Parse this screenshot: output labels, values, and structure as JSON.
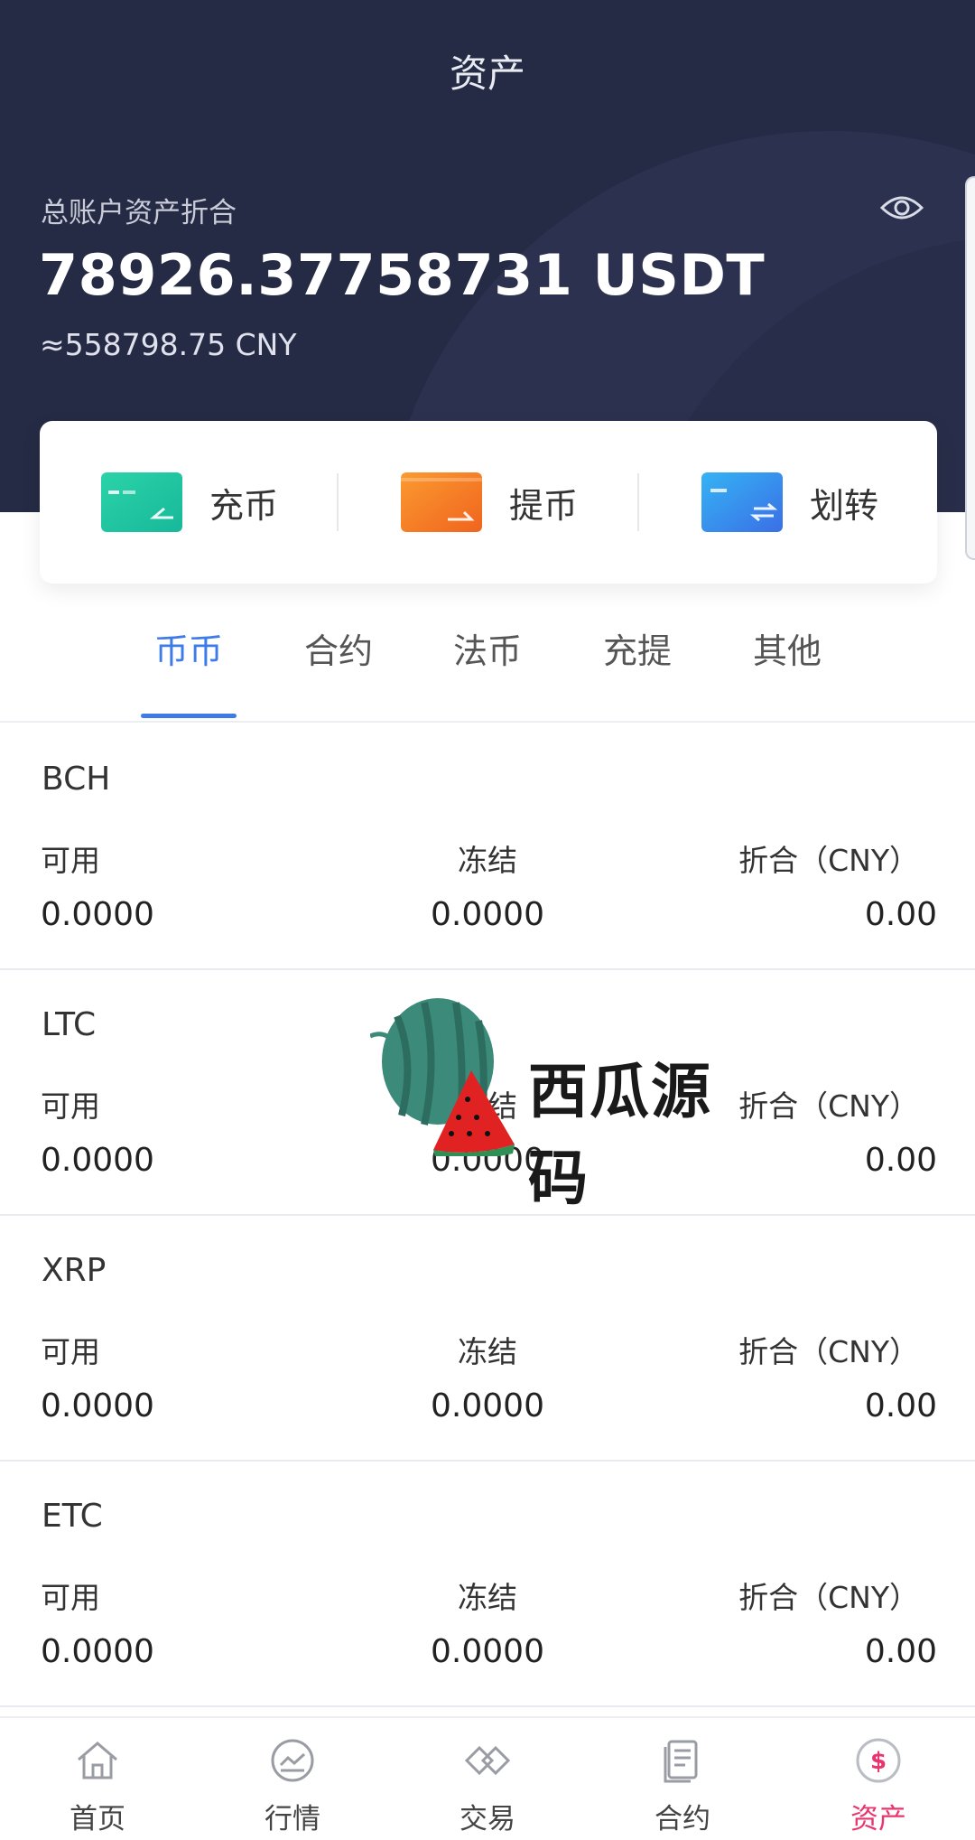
{
  "header": {
    "title": "资产",
    "assets_label": "总账户资产折合",
    "total_amount": "78926.37758731 USDT",
    "total_cny": "≈558798.75 CNY"
  },
  "actions": [
    {
      "label": "充币",
      "icon": "deposit-card-icon",
      "color": "#1fc7a3"
    },
    {
      "label": "提币",
      "icon": "withdraw-wallet-icon",
      "color": "#f47b27"
    },
    {
      "label": "划转",
      "icon": "transfer-card-icon",
      "color": "#3c8ff0"
    }
  ],
  "tabs": [
    {
      "label": "币币",
      "active": true
    },
    {
      "label": "合约",
      "active": false
    },
    {
      "label": "法币",
      "active": false
    },
    {
      "label": "充提",
      "active": false
    },
    {
      "label": "其他",
      "active": false
    }
  ],
  "coins": [
    {
      "symbol": "BCH",
      "available_label": "可用",
      "frozen_label": "冻结",
      "cny_label": "折合（CNY）",
      "available": "0.0000",
      "frozen": "0.0000",
      "cny": "0.00"
    },
    {
      "symbol": "LTC",
      "available_label": "可用",
      "frozen_label": "冻结",
      "cny_label": "折合（CNY）",
      "available": "0.0000",
      "frozen": "0.0000",
      "cny": "0.00"
    },
    {
      "symbol": "XRP",
      "available_label": "可用",
      "frozen_label": "冻结",
      "cny_label": "折合（CNY）",
      "available": "0.0000",
      "frozen": "0.0000",
      "cny": "0.00"
    },
    {
      "symbol": "ETC",
      "available_label": "可用",
      "frozen_label": "冻结",
      "cny_label": "折合（CNY）",
      "available": "0.0000",
      "frozen": "0.0000",
      "cny": "0.00"
    }
  ],
  "watermark": {
    "text": "西瓜源码"
  },
  "bottom_nav": [
    {
      "label": "首页",
      "icon": "home-icon",
      "active": false
    },
    {
      "label": "行情",
      "icon": "market-chart-icon",
      "active": false
    },
    {
      "label": "交易",
      "icon": "trade-diamond-icon",
      "active": false
    },
    {
      "label": "合约",
      "icon": "contract-document-icon",
      "active": false
    },
    {
      "label": "资产",
      "icon": "assets-dollar-icon",
      "active": true
    }
  ],
  "colors": {
    "header_bg": "#262b45",
    "accent_blue": "#3d7be8",
    "active_nav": "#e9356e"
  }
}
